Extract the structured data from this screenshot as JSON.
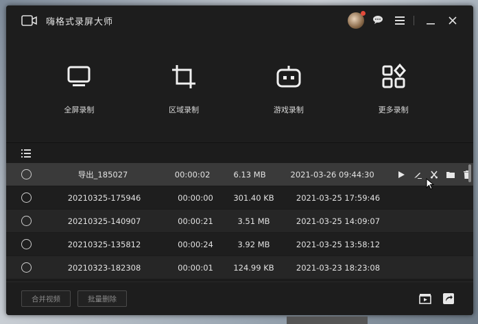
{
  "app": {
    "title": "嗨格式录屏大师"
  },
  "modes": [
    {
      "label": "全屏录制",
      "icon": "monitor-icon"
    },
    {
      "label": "区域录制",
      "icon": "crop-icon"
    },
    {
      "label": "游戏录制",
      "icon": "gamepad-icon"
    },
    {
      "label": "更多录制",
      "icon": "apps-grid-icon"
    }
  ],
  "recordings": [
    {
      "name": "导出_185027",
      "duration": "00:00:02",
      "size": "6.13 MB",
      "date": "2021-03-26 09:44:30"
    },
    {
      "name": "20210325-175946",
      "duration": "00:00:00",
      "size": "301.40 KB",
      "date": "2021-03-25 17:59:46"
    },
    {
      "name": "20210325-140907",
      "duration": "00:00:21",
      "size": "3.51 MB",
      "date": "2021-03-25 14:09:07"
    },
    {
      "name": "20210325-135812",
      "duration": "00:00:24",
      "size": "3.92 MB",
      "date": "2021-03-25 13:58:12"
    },
    {
      "name": "20210323-182308",
      "duration": "00:00:01",
      "size": "124.99 KB",
      "date": "2021-03-23 18:23:08"
    }
  ],
  "footer": {
    "merge_label": "合并视频",
    "batch_delete_label": "批量删除"
  },
  "colors": {
    "window_bg": "#1e1e1e",
    "selected_row": "#3a3a3a",
    "text": "#e2e2e2"
  }
}
